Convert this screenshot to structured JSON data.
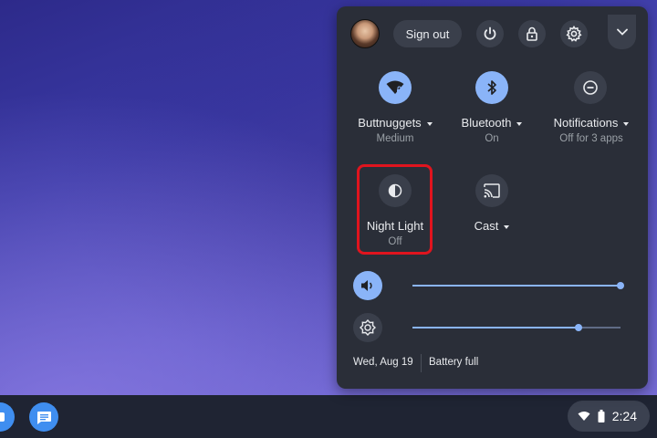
{
  "header": {
    "sign_out_label": "Sign out"
  },
  "tiles": [
    {
      "label": "Buttnuggets",
      "sublabel": "Medium",
      "icon": "wifi-icon",
      "state": "on"
    },
    {
      "label": "Bluetooth",
      "sublabel": "On",
      "icon": "bluetooth-icon",
      "state": "on"
    },
    {
      "label": "Notifications",
      "sublabel": "Off for 3 apps",
      "icon": "do-not-disturb-icon",
      "state": "off"
    },
    {
      "label": "Night Light",
      "sublabel": "Off",
      "icon": "night-light-icon",
      "state": "off"
    },
    {
      "label": "Cast",
      "sublabel": "",
      "icon": "cast-icon",
      "state": "off"
    }
  ],
  "sliders": {
    "volume": 0.99,
    "brightness": 0.79
  },
  "footer": {
    "date": "Wed, Aug 19",
    "battery": "Battery full"
  },
  "status": {
    "time": "2:24"
  },
  "colors": {
    "accent": "#8ab4f8",
    "panel": "#2a2e38",
    "highlight": "#e0141e"
  }
}
